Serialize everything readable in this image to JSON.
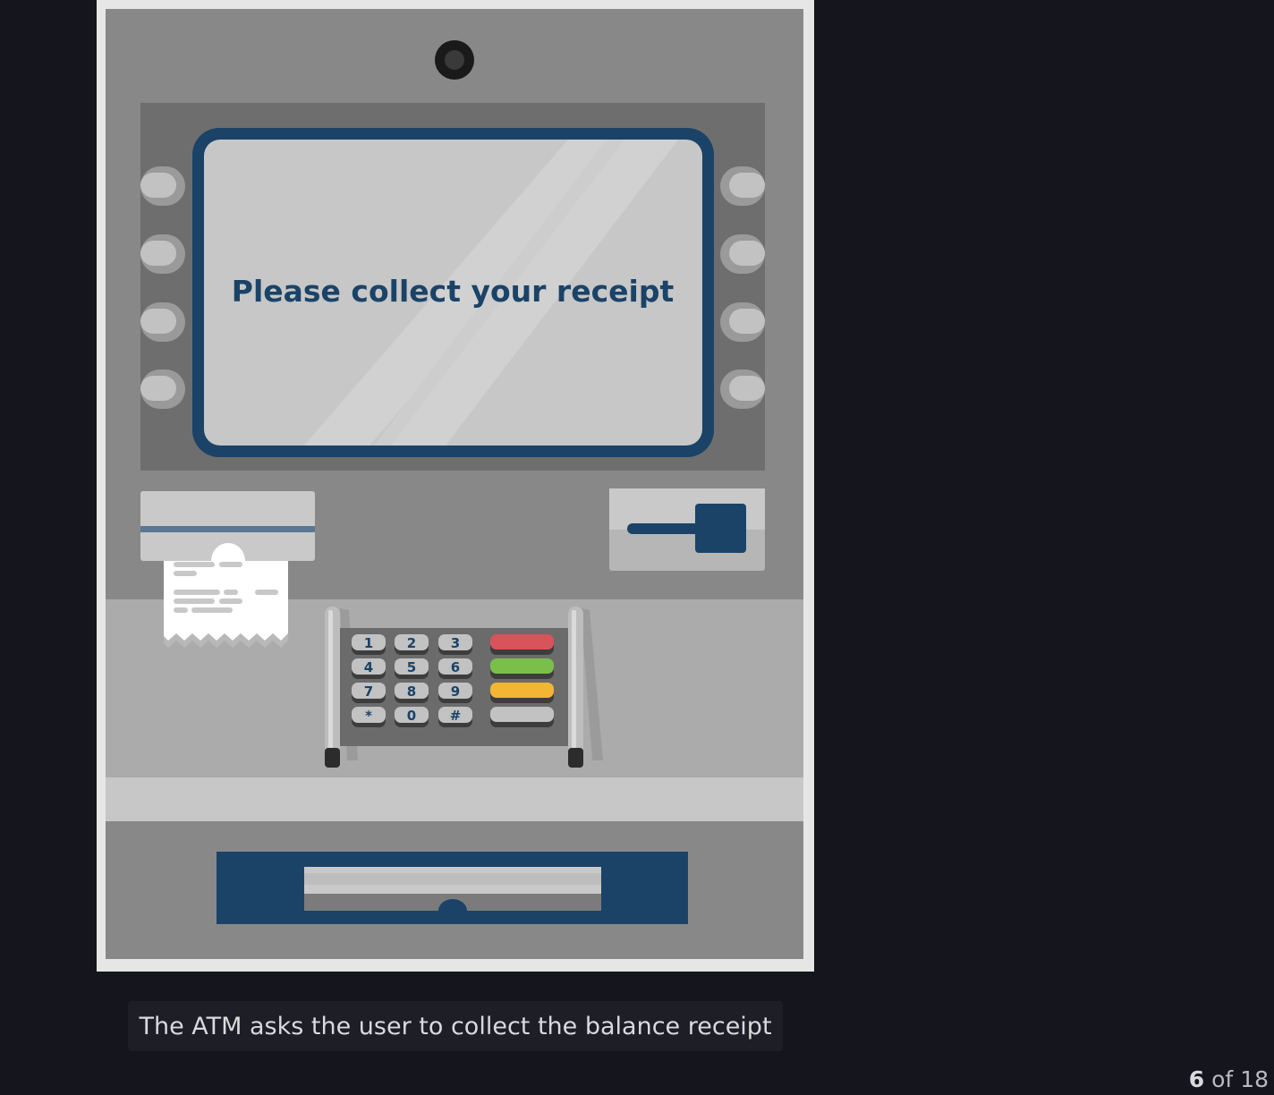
{
  "screen": {
    "message": "Please collect your receipt"
  },
  "keypad": {
    "keys": [
      "1",
      "2",
      "3",
      "4",
      "5",
      "6",
      "7",
      "8",
      "9",
      "*",
      "0",
      "#"
    ],
    "function_keys": [
      {
        "name": "cancel-key",
        "color": "#d9535b"
      },
      {
        "name": "clear-key",
        "color": "#7bbf4b"
      },
      {
        "name": "enter-key",
        "color": "#f2b534"
      },
      {
        "name": "blank-key",
        "color": "#c2c2c2"
      }
    ]
  },
  "colors": {
    "accent": "#1b4368",
    "background": "#15151e",
    "machine_body": "#888888"
  },
  "caption": "The ATM asks the user to collect the balance receipt",
  "pagination": {
    "current": "6",
    "separator": "of",
    "total": "18"
  }
}
